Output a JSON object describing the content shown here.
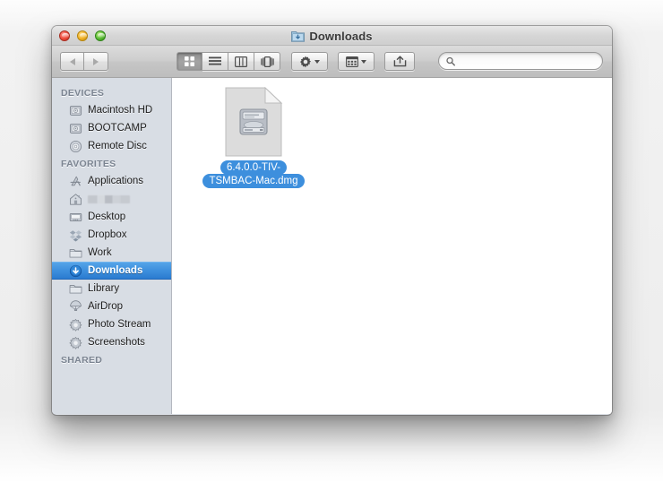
{
  "window": {
    "title": "Downloads",
    "title_icon": "downloads-folder-icon",
    "traffic_lights": [
      {
        "name": "close",
        "color": "#ee4b3c"
      },
      {
        "name": "minimize",
        "color": "#f0b024"
      },
      {
        "name": "zoom",
        "color": "#58bb32"
      }
    ]
  },
  "toolbar": {
    "back_label": "Back",
    "forward_label": "Forward",
    "view_modes": [
      {
        "name": "icon-view",
        "label": "Icon View",
        "active": true
      },
      {
        "name": "list-view",
        "label": "List View",
        "active": false
      },
      {
        "name": "column-view",
        "label": "Column View",
        "active": false
      },
      {
        "name": "coverflow-view",
        "label": "Cover Flow View",
        "active": false
      }
    ],
    "action_menu_label": "Action",
    "arrange_menu_label": "Arrange",
    "share_label": "Share",
    "search": {
      "value": "",
      "placeholder": ""
    }
  },
  "sidebar": {
    "sections": [
      {
        "header": "DEVICES",
        "items": [
          {
            "label": "Macintosh HD",
            "icon": "hard-drive-icon",
            "selected": false,
            "redacted": false
          },
          {
            "label": "BOOTCAMP",
            "icon": "hard-drive-icon",
            "selected": false,
            "redacted": false
          },
          {
            "label": "Remote Disc",
            "icon": "optical-disc-icon",
            "selected": false,
            "redacted": false
          }
        ]
      },
      {
        "header": "FAVORITES",
        "items": [
          {
            "label": "Applications",
            "icon": "applications-icon",
            "selected": false,
            "redacted": false
          },
          {
            "label": "",
            "icon": "home-icon",
            "selected": false,
            "redacted": true
          },
          {
            "label": "Desktop",
            "icon": "desktop-icon",
            "selected": false,
            "redacted": false
          },
          {
            "label": "Dropbox",
            "icon": "dropbox-icon",
            "selected": false,
            "redacted": false
          },
          {
            "label": "Work",
            "icon": "folder-icon",
            "selected": false,
            "redacted": false
          },
          {
            "label": "Downloads",
            "icon": "downloads-icon",
            "selected": true,
            "redacted": false
          },
          {
            "label": "Library",
            "icon": "folder-icon",
            "selected": false,
            "redacted": false
          },
          {
            "label": "AirDrop",
            "icon": "airdrop-icon",
            "selected": false,
            "redacted": false
          },
          {
            "label": "Photo Stream",
            "icon": "smart-folder-icon",
            "selected": false,
            "redacted": false
          },
          {
            "label": "Screenshots",
            "icon": "smart-folder-icon",
            "selected": false,
            "redacted": false
          }
        ]
      },
      {
        "header": "SHARED",
        "items": []
      }
    ]
  },
  "content": {
    "files": [
      {
        "name_line1": "6.4.0.0-TIV-",
        "name_line2": "TSMBAC-Mac.dmg",
        "full_name": "6.4.0.0-TIV-TSMBAC-Mac.dmg",
        "icon": "disk-image-icon",
        "selected": true
      }
    ]
  },
  "colors": {
    "selection_blue": "#3d8fdd",
    "sidebar_bg": "#d8dde4",
    "content_bg": "#ffffff",
    "section_header": "#7b8491"
  }
}
